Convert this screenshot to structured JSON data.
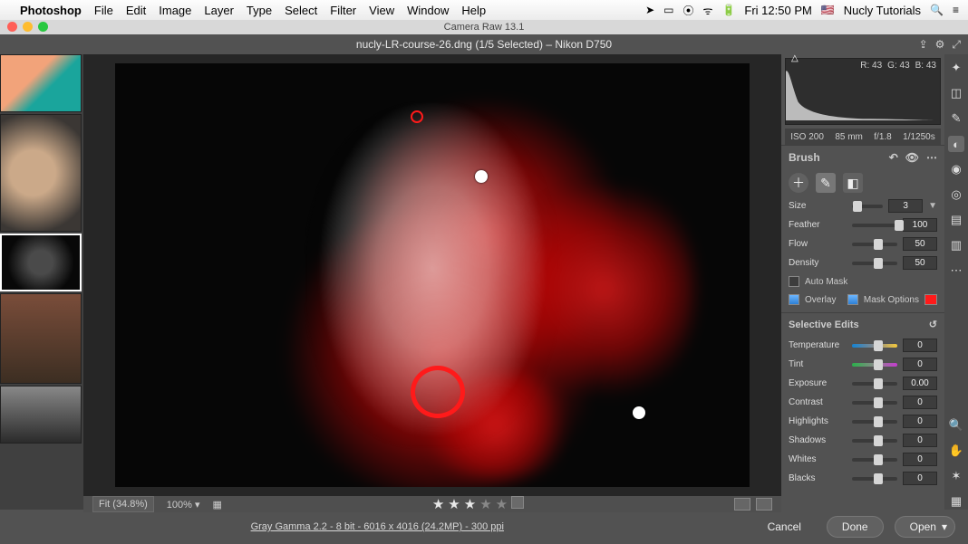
{
  "menubar": {
    "app": "Photoshop",
    "items": [
      "File",
      "Edit",
      "Image",
      "Layer",
      "Type",
      "Select",
      "Filter",
      "View",
      "Window",
      "Help"
    ],
    "clock": "Fri 12:50 PM",
    "flag": "🇺🇸",
    "user": "Nucly Tutorials"
  },
  "window": {
    "title": "Camera Raw 13.1"
  },
  "document": {
    "title": "nucly-LR-course-26.dng (1/5 Selected)  –  Nikon D750"
  },
  "histogram": {
    "r": "R: 43",
    "g": "G: 43",
    "b": "B: 43"
  },
  "meta": {
    "iso": "ISO 200",
    "focal": "85 mm",
    "aperture": "f/1.8",
    "shutter": "1/1250s"
  },
  "brush": {
    "title": "Brush",
    "size_label": "Size",
    "size_value": "3",
    "feather_label": "Feather",
    "feather_value": "100",
    "flow_label": "Flow",
    "flow_value": "50",
    "density_label": "Density",
    "density_value": "50",
    "automask_label": "Auto Mask",
    "overlay_label": "Overlay",
    "maskoptions_label": "Mask Options"
  },
  "selective": {
    "title": "Selective Edits",
    "temperature_label": "Temperature",
    "temperature_value": "0",
    "tint_label": "Tint",
    "tint_value": "0",
    "exposure_label": "Exposure",
    "exposure_value": "0.00",
    "contrast_label": "Contrast",
    "contrast_value": "0",
    "highlights_label": "Highlights",
    "highlights_value": "0",
    "shadows_label": "Shadows",
    "shadows_value": "0",
    "whites_label": "Whites",
    "whites_value": "0",
    "blacks_label": "Blacks",
    "blacks_value": "0"
  },
  "bottom": {
    "fit": "Fit (34.8%)",
    "zoom": "100%",
    "stars": 3
  },
  "footer": {
    "info": "Gray Gamma 2.2 - 8 bit - 6016 x 4016 (24.2MP) - 300 ppi",
    "cancel": "Cancel",
    "done": "Done",
    "open": "Open"
  }
}
